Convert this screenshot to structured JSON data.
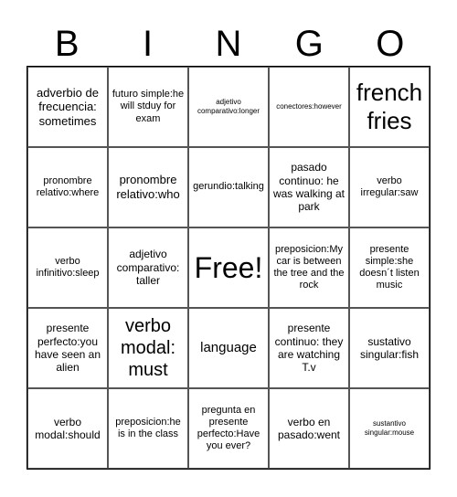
{
  "header": [
    "B",
    "I",
    "N",
    "G",
    "O"
  ],
  "cells": [
    [
      "adverbio de frecuencia: sometimes",
      "futuro simple:he will stduy for exam",
      "adjetivo comparativo:longer",
      "conectores:however",
      "french fries"
    ],
    [
      "pronombre relativo:where",
      "pronombre relativo:who",
      "gerundio:talking",
      "pasado continuo: he was walking at park",
      "verbo irregular:saw"
    ],
    [
      "verbo infinitivo:sleep",
      "adjetivo comparativo: taller",
      "Free!",
      "preposicion:My car is between the tree and the rock",
      "presente simple:she doesn´t listen music"
    ],
    [
      "presente perfecto:you have seen an alien",
      "verbo modal: must",
      "language",
      "presente continuo: they are watching T.v",
      "sustativo singular:fish"
    ],
    [
      "verbo modal:should",
      "preposicion:he is in the class",
      "pregunta en presente perfecto:Have you ever?",
      "verbo en pasado:went",
      "sustantivo singular:mouse"
    ]
  ]
}
